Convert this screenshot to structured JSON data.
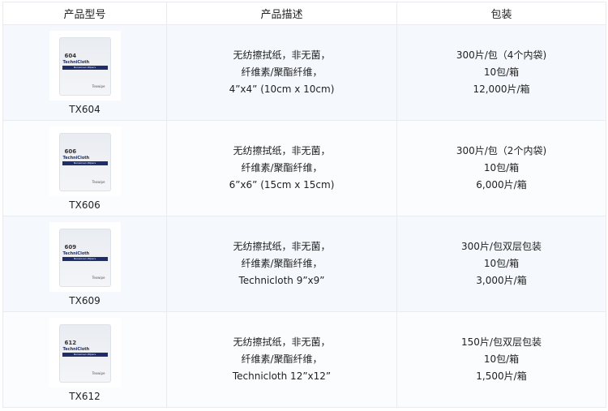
{
  "headers": [
    "产品型号",
    "产品描述",
    "包装"
  ],
  "rows": [
    {
      "model": "TX604",
      "pkg_num": "604",
      "brand": "TechniCloth",
      "band": "Nonwoven Wipers",
      "maker": "Texwipe",
      "desc": [
        "无纺擦拭纸，非无菌，",
        "纤维素/聚酯纤维，",
        "4”x4” (10cm x 10cm)"
      ],
      "pack": [
        "300片/包（4个内袋)",
        "10包/箱",
        "12,000片/箱"
      ]
    },
    {
      "model": "TX606",
      "pkg_num": "606",
      "brand": "TechniCloth",
      "band": "Nonwoven Wipers",
      "maker": "Texwipe",
      "desc": [
        "无纺擦拭纸，非无菌，",
        "纤维素/聚酯纤维，",
        "6”x6” (15cm x 15cm)"
      ],
      "pack": [
        "300片/包（2个内袋)",
        "10包/箱",
        "6,000片/箱"
      ]
    },
    {
      "model": "TX609",
      "pkg_num": "609",
      "brand": "TechniCloth",
      "band": "Nonwoven Wipers",
      "maker": "Texwipe",
      "desc": [
        "无纺擦拭纸，非无菌，",
        "纤维素/聚酯纤维，",
        "Technicloth 9”x9”"
      ],
      "pack": [
        "300片/包双层包装",
        "10包/箱",
        "3,000片/箱"
      ]
    },
    {
      "model": "TX612",
      "pkg_num": "612",
      "brand": "TechniCloth",
      "band": "Nonwoven Wipers",
      "maker": "Texwipe",
      "desc": [
        "无纺擦拭纸，非无菌，",
        "纤维素/聚酯纤维，",
        "Technicloth 12”x12”"
      ],
      "pack": [
        "150片/包双层包装",
        "10包/箱",
        "1,500片/箱"
      ]
    }
  ]
}
